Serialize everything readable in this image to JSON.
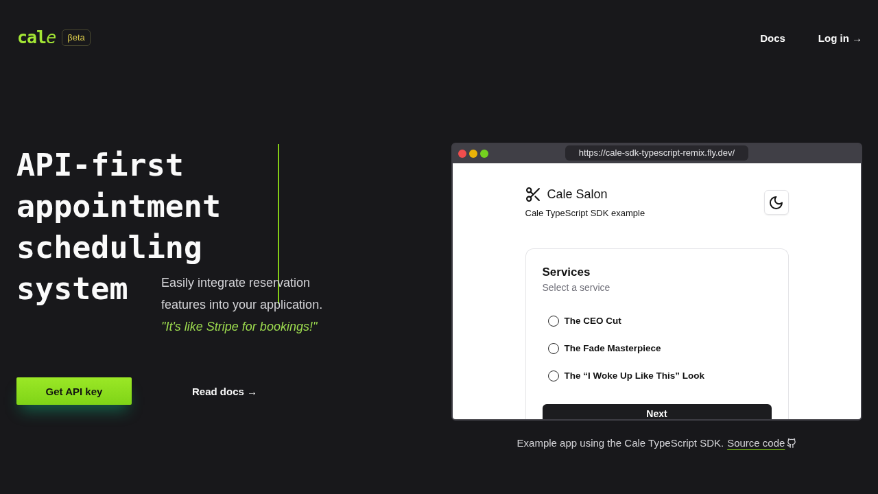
{
  "header": {
    "logo": "cale",
    "badge": "βeta",
    "nav": [
      {
        "label": "Docs"
      },
      {
        "label": "Log in →"
      }
    ]
  },
  "hero": {
    "title_lines": [
      "API-first",
      "appointment",
      "scheduling",
      "system"
    ],
    "description": "Easily integrate reservation features into your application.",
    "quote": "\"It's like Stripe for bookings!\"",
    "actions": [
      {
        "label": "Get API key",
        "kind": "primary"
      },
      {
        "label": "Read docs →",
        "kind": "link"
      }
    ]
  },
  "demo": {
    "browser": {
      "url": "https://cale-sdk-typescript-remix.fly.dev/"
    },
    "app": {
      "title": "Cale Salon",
      "subtitle": "Cale TypeScript SDK example",
      "card": {
        "title": "Services",
        "subtitle": "Select a service",
        "options": [
          {
            "label": "The CEO Cut",
            "selected": false
          },
          {
            "label": "The Fade Masterpiece",
            "selected": false
          },
          {
            "label": "The “I Woke Up Like This” Look",
            "selected": false
          }
        ],
        "button": "Next"
      }
    },
    "caption": {
      "text": "Example app using the Cale TypeScript SDK.",
      "link": "Source code"
    }
  }
}
